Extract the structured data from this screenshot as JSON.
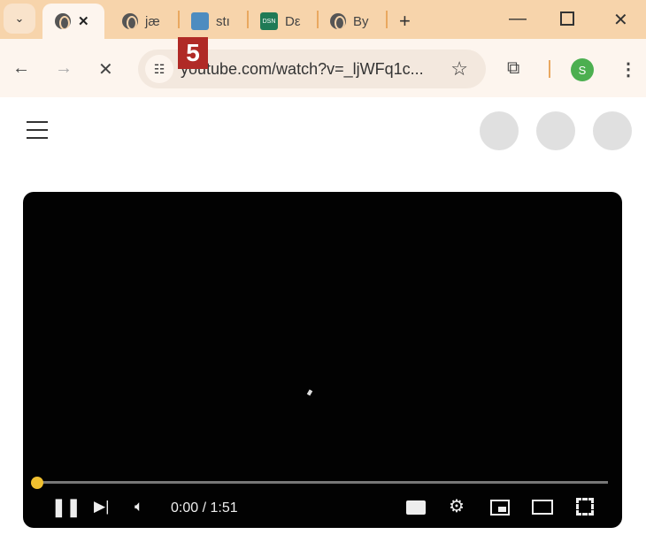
{
  "browser": {
    "tabs": [
      {
        "label": "",
        "active": true
      },
      {
        "label": "jæ"
      },
      {
        "label": "stı"
      },
      {
        "label": "Dε",
        "favicon_text": "DSN"
      },
      {
        "label": "By"
      }
    ],
    "new_tab": "+",
    "url": "youtube.com/watch?v=_ljWFq1c...",
    "profile_initial": "S",
    "annotation_label": "5"
  },
  "player": {
    "time": "0:00 / 1:51",
    "progress": 0,
    "accent": "#f0c030"
  }
}
